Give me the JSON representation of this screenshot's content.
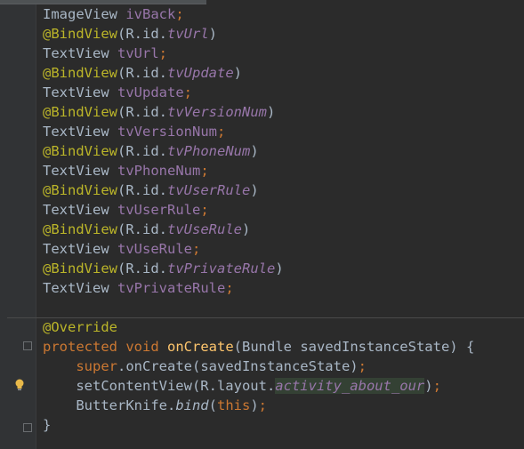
{
  "code": {
    "lines": [
      {
        "type": "ImageView ",
        "var": "ivBack",
        "end": ";"
      },
      {
        "ann": "@BindView",
        "open": "(R.id.",
        "id": "tvUrl",
        "close": ")"
      },
      {
        "type": "TextView ",
        "var": "tvUrl",
        "end": ";"
      },
      {
        "ann": "@BindView",
        "open": "(R.id.",
        "id": "tvUpdate",
        "close": ")"
      },
      {
        "type": "TextView ",
        "var": "tvUpdate",
        "end": ";"
      },
      {
        "ann": "@BindView",
        "open": "(R.id.",
        "id": "tvVersionNum",
        "close": ")"
      },
      {
        "type": "TextView ",
        "var": "tvVersionNum",
        "end": ";"
      },
      {
        "ann": "@BindView",
        "open": "(R.id.",
        "id": "tvPhoneNum",
        "close": ")"
      },
      {
        "type": "TextView ",
        "var": "tvPhoneNum",
        "end": ";"
      },
      {
        "ann": "@BindView",
        "open": "(R.id.",
        "id": "tvUserRule",
        "close": ")"
      },
      {
        "type": "TextView ",
        "var": "tvUserRule",
        "end": ";"
      },
      {
        "ann": "@BindView",
        "open": "(R.id.",
        "id": "tvUseRule",
        "close": ")"
      },
      {
        "type": "TextView ",
        "var": "tvUseRule",
        "end": ";"
      },
      {
        "ann": "@BindView",
        "open": "(R.id.",
        "id": "tvPrivateRule",
        "close": ")"
      },
      {
        "type": "TextView ",
        "var": "tvPrivateRule",
        "end": ";"
      }
    ],
    "method": {
      "override": "@Override",
      "sig_kw1": "protected",
      "sig_kw2": "void",
      "sig_name": "onCreate",
      "sig_params": "(Bundle savedInstanceState) {",
      "super_kw": "super",
      "super_call": ".onCreate(savedInstanceState)",
      "semi": ";",
      "set_call": "setContentView(R.layout.",
      "layout_id": "activity_about_our",
      "set_close": ")",
      "bk_class": "ButterKnife.",
      "bk_method": "bind",
      "bk_open": "(",
      "bk_this": "this",
      "bk_close": ")",
      "close_brace": "}"
    }
  },
  "icons": {
    "intention": "lightbulb-icon"
  },
  "colors": {
    "background": "#2b2b2b",
    "annotation": "#bbb529",
    "keyword": "#cc7832",
    "field": "#9876aa",
    "method": "#ffc66d",
    "text": "#a9b7c6"
  }
}
